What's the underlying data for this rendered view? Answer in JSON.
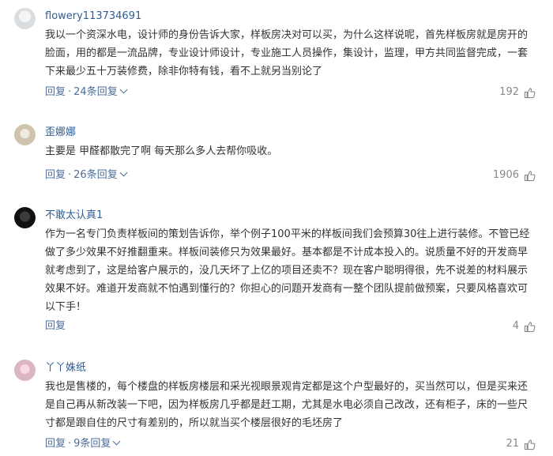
{
  "comments": [
    {
      "username": "flowery113734691",
      "text": "我以一个资深水电，设计师的身份告诉大家，样板房决对可以买，为什么这样说呢，首先样板房就是房开的脸面，用的都是一流品牌，专业设计师设计，专业施工人员操作，集设计，监理，甲方共同监督完成，一套下来最少五十万装修费，除非你特有钱，看不上就另当别论了",
      "reply_label": "回复",
      "replies_label": "24条回复",
      "likes": "192"
    },
    {
      "username": "歪娜娜",
      "text": "主要是 甲醛都散完了啊 每天那么多人去帮你吸收。",
      "reply_label": "回复",
      "replies_label": "26条回复",
      "likes": "1906"
    },
    {
      "username": "不敢太认真1",
      "text": "作为一名专门负责样板间的策划告诉你，举个例子100平米的样板间我们会预算30往上进行装修。不管已经做了多少效果不好推翻重来。样板间装修只为效果最好。基本都是不计成本投入的。说质量不好的开发商早就考虑到了，这是给客户展示的，没几天坏了上亿的项目还卖不？现在客户聪明得很，先不说差的材料展示效果不好。难道开发商就不怕遇到懂行的？你担心的问题开发商有一整个团队提前做预案，只要风格喜欢可以下手！",
      "reply_label": "回复",
      "replies_label": "",
      "likes": "4"
    },
    {
      "username": "丫丫姝纸",
      "text": "我也是售楼的，每个楼盘的样板房楼层和采光视眼景观肯定都是这个户型最好的，买当然可以，但是买来还是自己再从新改装一下吧，因为样板房几乎都是赶工期，尤其是水电必须自己改改，还有柜子，床的一些尺寸都是跟自住的尺寸有差别的，所以就当买个楼层很好的毛坯房了",
      "reply_label": "回复",
      "replies_label": "9条回复",
      "likes": "21"
    }
  ],
  "colors": {
    "username": "#2f5c95",
    "meta": "#4c6d99",
    "likes": "#888888",
    "text": "#333333"
  },
  "icons": {
    "like": "thumb-up-icon",
    "expand": "chevron-down-icon"
  }
}
